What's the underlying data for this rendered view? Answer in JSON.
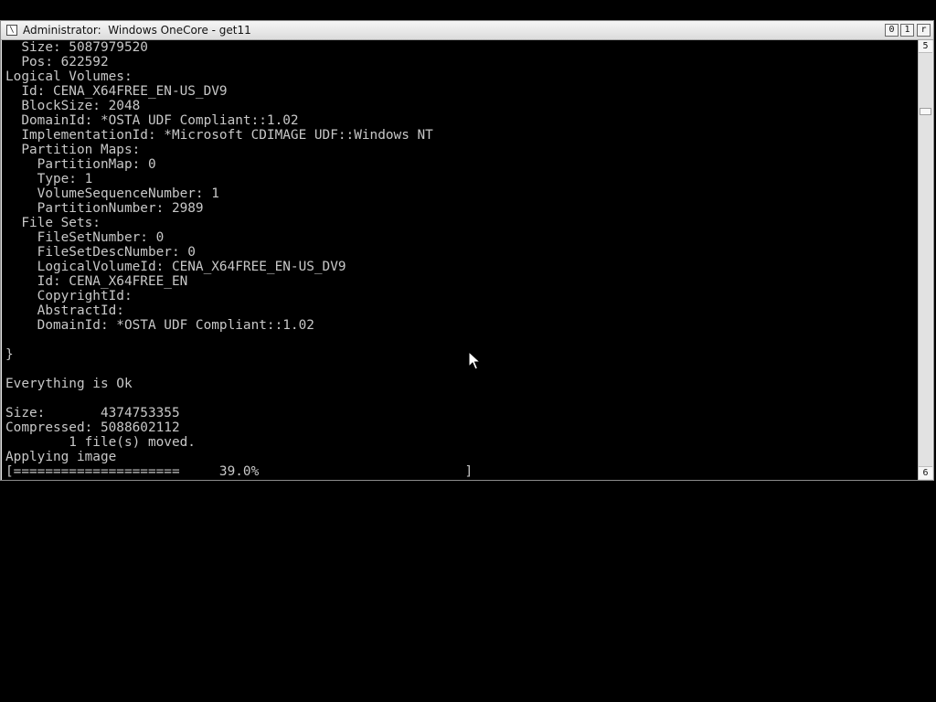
{
  "window": {
    "title": "Administrator:  Windows OneCore - get11",
    "icon_glyph": "\\",
    "buttons": {
      "minimize": "0",
      "maximize": "1",
      "close": "r"
    }
  },
  "console": {
    "lines": [
      "  Size: 5087979520",
      "  Pos: 622592",
      "Logical Volumes:",
      "  Id: CENA_X64FREE_EN-US_DV9",
      "  BlockSize: 2048",
      "  DomainId: *OSTA UDF Compliant::1.02",
      "  ImplementationId: *Microsoft CDIMAGE UDF::Windows NT",
      "  Partition Maps:",
      "    PartitionMap: 0",
      "    Type: 1",
      "    VolumeSequenceNumber: 1",
      "    PartitionNumber: 2989",
      "  File Sets:",
      "    FileSetNumber: 0",
      "    FileSetDescNumber: 0",
      "    LogicalVolumeId: CENA_X64FREE_EN-US_DV9",
      "    Id: CENA_X64FREE_EN",
      "    CopyrightId:",
      "    AbstractId:",
      "    DomainId: *OSTA UDF Compliant::1.02",
      "",
      "}",
      "",
      "Everything is Ok",
      "",
      "Size:       4374753355",
      "Compressed: 5088602112",
      "        1 file(s) moved.",
      "Applying image",
      "[=====================     39.0%                          ]"
    ],
    "progress_percent": 39.0
  },
  "scrollbar": {
    "up_glyph": "5",
    "down_glyph": "6"
  },
  "cursor": {
    "icon": "arrow-pointer"
  },
  "colors": {
    "console_background": "#000000",
    "console_text": "#c8c8c8",
    "titlebar": "#e6e6e6"
  }
}
